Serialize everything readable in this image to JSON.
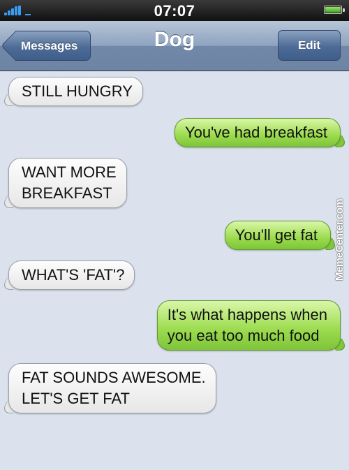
{
  "status_bar": {
    "time": "07:07",
    "battery_color": "#3aa81d",
    "signal_color": "#3a9bf0"
  },
  "nav_bar": {
    "back_label": "Messages",
    "title": "Dog",
    "edit_label": "Edit"
  },
  "messages": [
    {
      "direction": "incoming",
      "text": "STILL HUNGRY"
    },
    {
      "direction": "outgoing",
      "text": "You've had breakfast"
    },
    {
      "direction": "incoming",
      "text": "WANT MORE\nBREAKFAST"
    },
    {
      "direction": "outgoing",
      "text": "You'll get fat"
    },
    {
      "direction": "incoming",
      "text": "WHAT'S 'FAT'?"
    },
    {
      "direction": "outgoing",
      "text": "It's what happens when\nyou eat too much food"
    },
    {
      "direction": "incoming",
      "text": "FAT SOUNDS AWESOME.\nLET'S GET FAT"
    }
  ],
  "watermark": "MemeCenter.com"
}
